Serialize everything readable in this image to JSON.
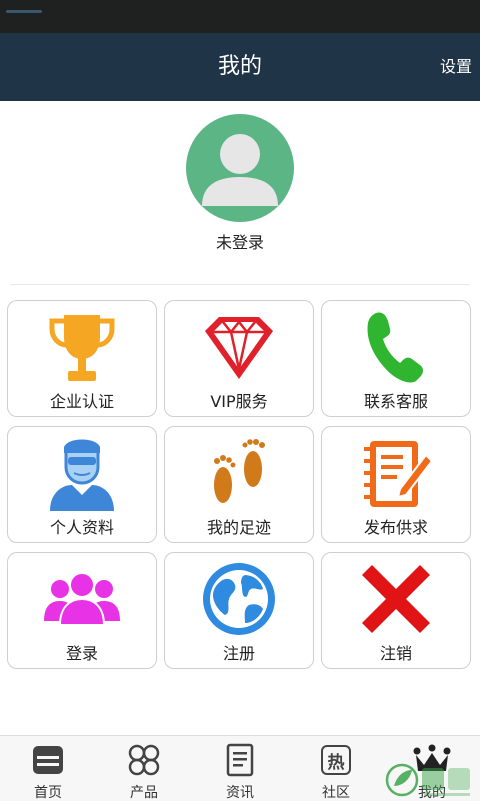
{
  "header": {
    "title": "我的",
    "settings_label": "设置"
  },
  "profile": {
    "status": "未登录"
  },
  "menu": [
    {
      "label": "企业认证",
      "icon": "trophy-icon"
    },
    {
      "label": "VIP服务",
      "icon": "diamond-icon"
    },
    {
      "label": "联系客服",
      "icon": "phone-icon"
    },
    {
      "label": "个人资料",
      "icon": "person-icon"
    },
    {
      "label": "我的足迹",
      "icon": "footprints-icon"
    },
    {
      "label": "发布供求",
      "icon": "notepad-pencil-icon"
    },
    {
      "label": "登录",
      "icon": "group-icon"
    },
    {
      "label": "注册",
      "icon": "globe-icon"
    },
    {
      "label": "注销",
      "icon": "cross-icon"
    }
  ],
  "tabs": [
    {
      "label": "首页",
      "icon": "home-icon"
    },
    {
      "label": "产品",
      "icon": "clover-icon"
    },
    {
      "label": "资讯",
      "icon": "document-icon"
    },
    {
      "label": "社区",
      "icon": "hot-icon",
      "glyph": "热"
    },
    {
      "label": "我的",
      "icon": "crown-icon"
    }
  ],
  "colors": {
    "header": "#1f3447",
    "statusbar": "#1f2121",
    "avatar": "#5cb585",
    "trophy": "#f5a623",
    "diamond": "#e0202a",
    "phone": "#2fb52f",
    "person": "#3e86d8",
    "footprints": "#d07a1a",
    "notepad": "#f06a1a",
    "group": "#e832e6",
    "globe": "#2f8be0",
    "cross": "#e01414"
  }
}
